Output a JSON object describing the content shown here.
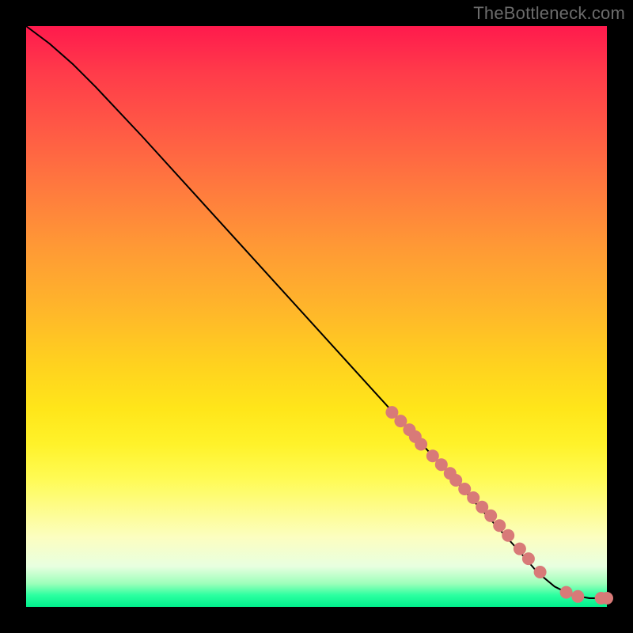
{
  "watermark": "TheBottleneck.com",
  "colors": {
    "dot": "#d87a78",
    "curve": "#000000"
  },
  "chart_data": {
    "type": "line",
    "title": "",
    "xlabel": "",
    "ylabel": "",
    "xlim": [
      0,
      100
    ],
    "ylim": [
      0,
      100
    ],
    "grid": false,
    "legend": false,
    "note": "Values are read from pixel positions relative to the 734×734 plot; axes are unlabeled so x/y are 0–100 normalized. Curve descends from top-left, straightens, and flattens near y≈0 at right. Scatter points (salmon) lie on the lower-right segment of the curve.",
    "series": [
      {
        "name": "curve",
        "kind": "line",
        "x": [
          0,
          4,
          8,
          12,
          20,
          30,
          40,
          50,
          60,
          65,
          70,
          75,
          80,
          85,
          88,
          91,
          94,
          97,
          100
        ],
        "y": [
          100,
          97,
          93.5,
          89.5,
          81,
          70,
          59,
          48,
          37,
          31.5,
          26,
          20.5,
          15,
          9.5,
          6,
          3.5,
          2,
          1.5,
          1.5
        ]
      },
      {
        "name": "points",
        "kind": "scatter",
        "x": [
          63,
          64.5,
          66,
          67,
          68,
          70,
          71.5,
          73,
          74,
          75.5,
          77,
          78.5,
          80,
          81.5,
          83,
          85,
          86.5,
          88.5,
          93,
          95,
          99,
          100
        ],
        "y": [
          33.5,
          32,
          30.5,
          29.3,
          28,
          26,
          24.5,
          23,
          21.8,
          20.3,
          18.8,
          17.2,
          15.7,
          14,
          12.3,
          10,
          8.3,
          6,
          2.5,
          1.8,
          1.5,
          1.5
        ]
      }
    ]
  }
}
